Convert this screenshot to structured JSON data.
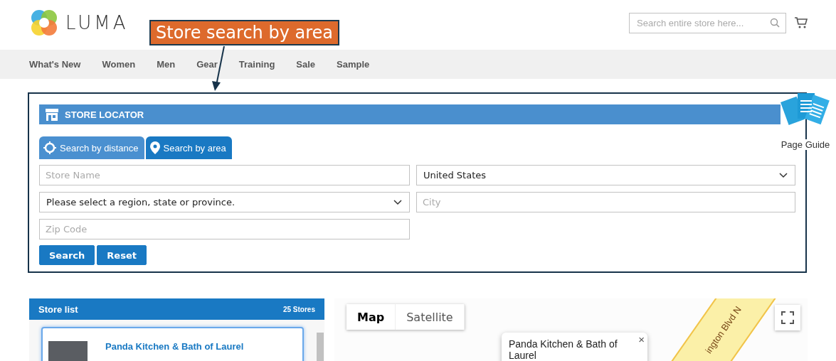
{
  "header": {
    "logo": "LUMA",
    "search": {
      "placeholder": "Search entire store here..."
    }
  },
  "nav": [
    "What's New",
    "Women",
    "Men",
    "Gear",
    "Training",
    "Sale",
    "Sample"
  ],
  "annotation": {
    "label": "Store search by area"
  },
  "page_guide": {
    "label": "Page Guide"
  },
  "store_locator": {
    "title": "STORE LOCATOR",
    "tabs": [
      {
        "label": "Search by distance",
        "kind": "distance",
        "selected": false
      },
      {
        "label": "Search by area",
        "kind": "area",
        "selected": true
      }
    ],
    "fields": {
      "store_name": {
        "placeholder": "Store Name"
      },
      "country": {
        "value": "United States"
      },
      "region": {
        "value": "Please select a region, state or province."
      },
      "city": {
        "placeholder": "City"
      },
      "zip": {
        "placeholder": "Zip Code"
      }
    },
    "buttons": [
      "Search",
      "Reset"
    ]
  },
  "store_list": {
    "title": "Store list",
    "count": "25 Stores",
    "stores": [
      {
        "name": "Panda Kitchen & Bath of Laurel"
      }
    ]
  },
  "map": {
    "types": [
      {
        "label": "Map",
        "selected": true
      },
      {
        "label": "Satellite",
        "selected": false
      }
    ],
    "road_label": "ington Blvd N",
    "popup": {
      "title": "Panda Kitchen & Bath of Laurel",
      "close": "×"
    }
  }
}
